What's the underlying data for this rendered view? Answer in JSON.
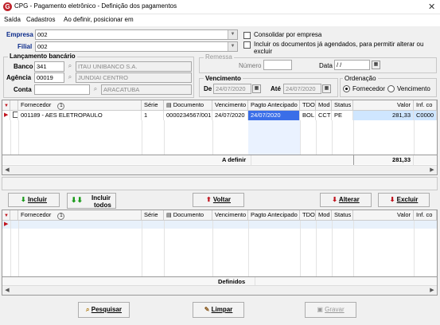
{
  "window": {
    "title": "CPG - Pagamento eletrônico - Definição dos pagamentos",
    "close": "✕",
    "icon": "G"
  },
  "menu": [
    "Saída",
    "Cadastros",
    "Ao definir, posicionar em"
  ],
  "empresa": {
    "label": "Empresa",
    "value": "002"
  },
  "filial": {
    "label": "Filial",
    "value": "002"
  },
  "options": {
    "consolidar": "Consolidar por empresa",
    "incluir_agendados": "Incluir os documentos já agendados, para permitir alterar ou excluir"
  },
  "lancamento": {
    "legend": "Lançamento bancário",
    "banco_label": "Banco",
    "banco_code": "341",
    "banco_name": "ITAU UNIBANCO S.A.",
    "agencia_label": "Agência",
    "agencia_code": "00019",
    "agencia_name": "JUNDIAI CENTRO",
    "conta_label": "Conta",
    "conta_value": "",
    "conta_name": "ARACATUBA"
  },
  "remessa": {
    "legend": "Remessa",
    "numero_label": "Número",
    "numero_value": "",
    "data_label": "Data",
    "data_value": "/  /"
  },
  "vencimento": {
    "legend": "Vencimento",
    "de_label": "De",
    "de_value": "24/07/2020",
    "ate_label": "Até",
    "ate_value": "24/07/2020"
  },
  "ordenacao": {
    "legend": "Ordenação",
    "opt1": "Fornecedor",
    "opt2": "Vencimento",
    "selected": "Fornecedor"
  },
  "grid1": {
    "headers": [
      "Fornecedor",
      "Série",
      "Documento",
      "Vencimento",
      "Pagto Antecipado",
      "TDO",
      "Mod",
      "Status",
      "Valor",
      "Inf. co"
    ],
    "badge": "1",
    "row": {
      "fornecedor": "001189 - AES ELETROPAULO",
      "serie": "1",
      "documento": "0000234567/001",
      "vencimento": "24/07/2020",
      "pagto": "24/07/2020",
      "tdo": "BOL",
      "mod": "CCT",
      "status": "PE",
      "valor": "281,33",
      "inf": "C0000"
    },
    "footer_label": "A definir",
    "footer_value": "281,33"
  },
  "buttons_mid": {
    "incluir": "Incluir",
    "incluir_todos_1": "Incluir",
    "incluir_todos_2": "todos",
    "voltar": "Voltar",
    "alterar": "Alterar",
    "excluir": "Excluir"
  },
  "grid2": {
    "headers": [
      "Fornecedor",
      "Série",
      "Documento",
      "Vencimento",
      "Pagto Antecipado",
      "TDO",
      "Mod",
      "Status",
      "Valor",
      "Inf. co"
    ],
    "badge": "1",
    "footer_label": "Definidos"
  },
  "buttons_bottom": {
    "pesquisar": "Pesquisar",
    "limpar": "Limpar",
    "gravar": "Gravar"
  }
}
